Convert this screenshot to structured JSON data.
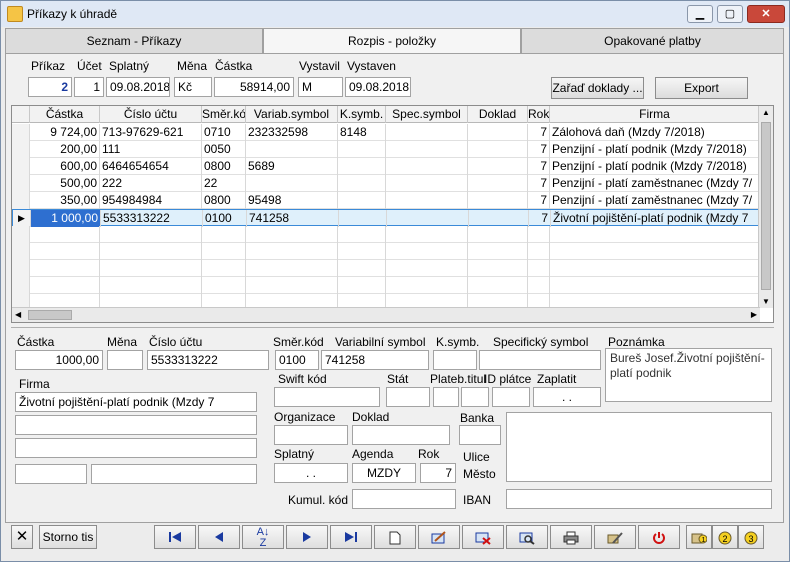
{
  "window": {
    "title": "Příkazy k úhradě"
  },
  "tabs": [
    {
      "label": "Seznam - Příkazy"
    },
    {
      "label": "Rozpis - položky"
    },
    {
      "label": "Opakované platby"
    }
  ],
  "header": {
    "labels": {
      "prikaz": "Příkaz",
      "ucet": "Účet",
      "splatny": "Splatný",
      "mena": "Měna",
      "castka": "Částka",
      "vystavil": "Vystavil",
      "vystaven": "Vystaven"
    },
    "values": {
      "prikaz": "2",
      "ucet": "1",
      "splatny": "09.08.2018",
      "mena": "Kč",
      "castka": "58914,00",
      "vystavil": "M",
      "vystaven": "09.08.2018"
    },
    "btn_zarad": "Zařaď doklady ...",
    "btn_export": "Export"
  },
  "grid": {
    "columns": [
      "Částka",
      "Číslo účtu",
      "Směr.kód",
      "Variab.symbol",
      "K.symb.",
      "Spec.symbol",
      "Doklad",
      "Rok",
      "Firma"
    ],
    "rows": [
      {
        "castka": "9 724,00",
        "ucet": "713-97629-621",
        "smer": "0710",
        "var": "232332598",
        "ksym": "8148",
        "spec": "",
        "doklad": "",
        "rok": "7",
        "firma": "Zálohová daň (Mzdy 7/2018)"
      },
      {
        "castka": "200,00",
        "ucet": "111",
        "smer": "0050",
        "var": "",
        "ksym": "",
        "spec": "",
        "doklad": "",
        "rok": "7",
        "firma": "Penzijní - platí podnik (Mzdy 7/2018)"
      },
      {
        "castka": "600,00",
        "ucet": "6464654654",
        "smer": "0800",
        "var": "5689",
        "ksym": "",
        "spec": "",
        "doklad": "",
        "rok": "7",
        "firma": "Penzijní - platí podnik (Mzdy 7/2018)"
      },
      {
        "castka": "500,00",
        "ucet": "222",
        "smer": "22",
        "var": "",
        "ksym": "",
        "spec": "",
        "doklad": "",
        "rok": "7",
        "firma": "Penzijní - platí zaměstnanec (Mzdy 7/"
      },
      {
        "castka": "350,00",
        "ucet": "954984984",
        "smer": "0800",
        "var": "95498",
        "ksym": "",
        "spec": "",
        "doklad": "",
        "rok": "7",
        "firma": "Penzijní - platí zaměstnanec (Mzdy 7/"
      },
      {
        "castka": "1 000,00",
        "ucet": "5533313222",
        "smer": "0100",
        "var": "741258",
        "ksym": "",
        "spec": "",
        "doklad": "",
        "rok": "7",
        "firma": "Životní pojištění-platí podnik (Mzdy 7"
      }
    ]
  },
  "detail": {
    "labels": {
      "castka": "Částka",
      "mena": "Měna",
      "ucet": "Číslo účtu",
      "smer": "Směr.kód",
      "var": "Variabilní symbol",
      "ksym": "K.symb.",
      "spec": "Specifický symbol",
      "poznamka": "Poznámka",
      "firma": "Firma",
      "swift": "Swift kód",
      "stat": "Stát",
      "plateb": "Plateb.titul",
      "idplatce": "ID plátce",
      "zaplatit": "Zaplatit",
      "organizace": "Organizace",
      "doklad": "Doklad",
      "banka": "Banka",
      "splatny": "Splatný",
      "agenda": "Agenda",
      "rok": "Rok",
      "ulice": "Ulice",
      "mesto": "Město",
      "kumul": "Kumul. kód",
      "iban": "IBAN"
    },
    "values": {
      "castka": "1000,00",
      "mena": "",
      "ucet": "5533313222",
      "smer": "0100",
      "var": "741258",
      "ksym": "",
      "spec": "",
      "poznamka": "Bureš Josef.Životní pojištění-platí podnik",
      "firma": "Životní pojištění-platí podnik (Mzdy 7",
      "zaplatit": ". .",
      "splatny": ". .",
      "agenda": "MZDY",
      "rok": "7"
    }
  },
  "bottom": {
    "storno": "Storno tis"
  }
}
